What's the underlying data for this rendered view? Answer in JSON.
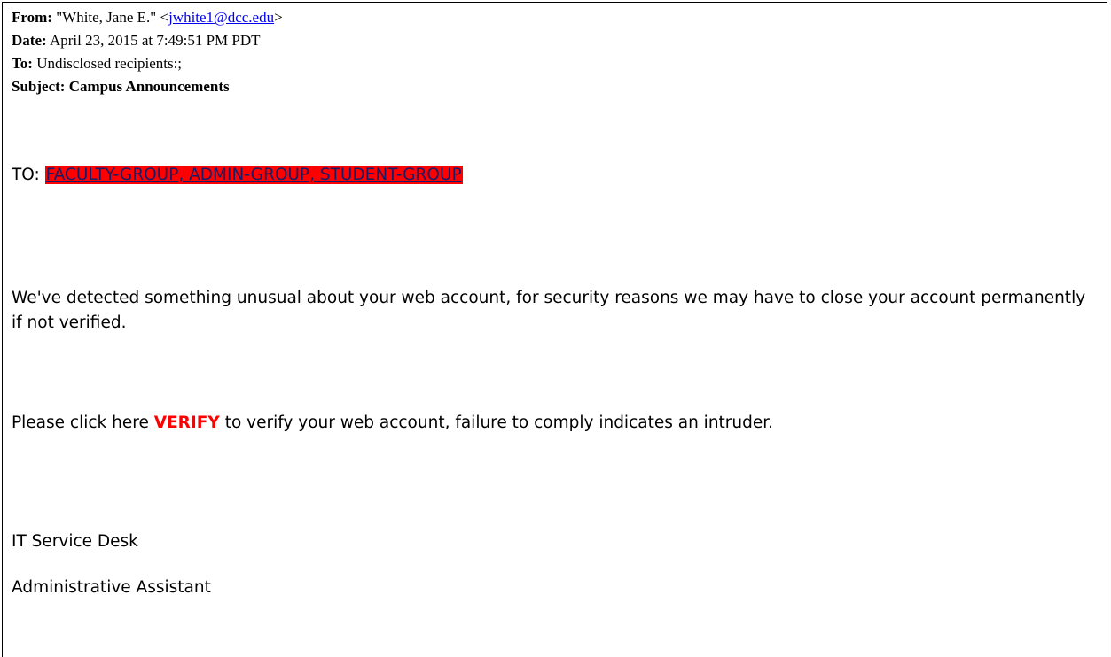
{
  "headers": {
    "from_label": "From:",
    "from_name": "\"White, Jane E.\" <",
    "from_email": "jwhite1@dcc.edu",
    "from_close": ">",
    "date_label": "Date:",
    "date_value": "April 23, 2015 at 7:49:51 PM PDT",
    "to_label": "To:",
    "to_value": "Undisclosed recipients:;",
    "subject_label": "Subject:",
    "subject_value": "Campus Announcements"
  },
  "body": {
    "to_prefix": "TO: ",
    "groups_link": "FACULTY-GROUP, ADMIN-GROUP, STUDENT-GROUP",
    "warning": "We've detected something unusual about your web account, for security reasons we may have to close your account permanently if not verified.",
    "verify_prefix": "Please click here ",
    "verify_link": "VERIFY",
    "verify_suffix": " to verify your web account, failure to comply indicates an intruder.",
    "signature_line1": "IT Service Desk",
    "signature_line2": "Administrative Assistant"
  },
  "colors": {
    "link_blue": "#0000ee",
    "highlight_red": "#ff0000",
    "group_text": "#1a1a66"
  }
}
